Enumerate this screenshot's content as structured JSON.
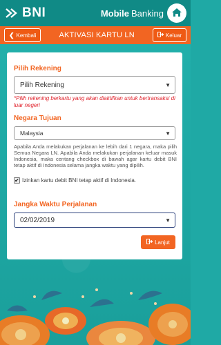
{
  "header": {
    "brand": "BNI",
    "title_bold": "Mobile",
    "title_rest": "Banking"
  },
  "nav": {
    "back_label": "Kembali",
    "title": "AKTIVASI KARTU LN",
    "exit_label": "Keluar"
  },
  "form": {
    "account": {
      "label": "Pilih Rekening",
      "value": "Pilih Rekening",
      "note": "*Pilih rekening berkartu yang akan diaktifkan untuk bertransaksi di luar negeri"
    },
    "country": {
      "label": "Negara Tujuan",
      "value": "Malaysia",
      "info": "Apabila Anda melakukan perjalanan ke lebih dari 1 negara, maka pilih Semua Negara LN. Apabila Anda melakukan perjalanan keluar masuk Indonesia, maka centang checkbox di bawah agar kartu debit BNI tetap aktif di Indonesia selama jangka waktu yang dipilih.",
      "checkbox_label": "Izinkan kartu debit BNI tetap aktif di Indonesia.",
      "checkbox_checked": true
    },
    "duration": {
      "label": "Jangka Waktu Perjalanan",
      "value": "02/02/2019"
    },
    "next_label": "Lanjut"
  },
  "colors": {
    "brand_teal": "#108a86",
    "accent_orange": "#f26522",
    "note_red": "#e0202a"
  }
}
